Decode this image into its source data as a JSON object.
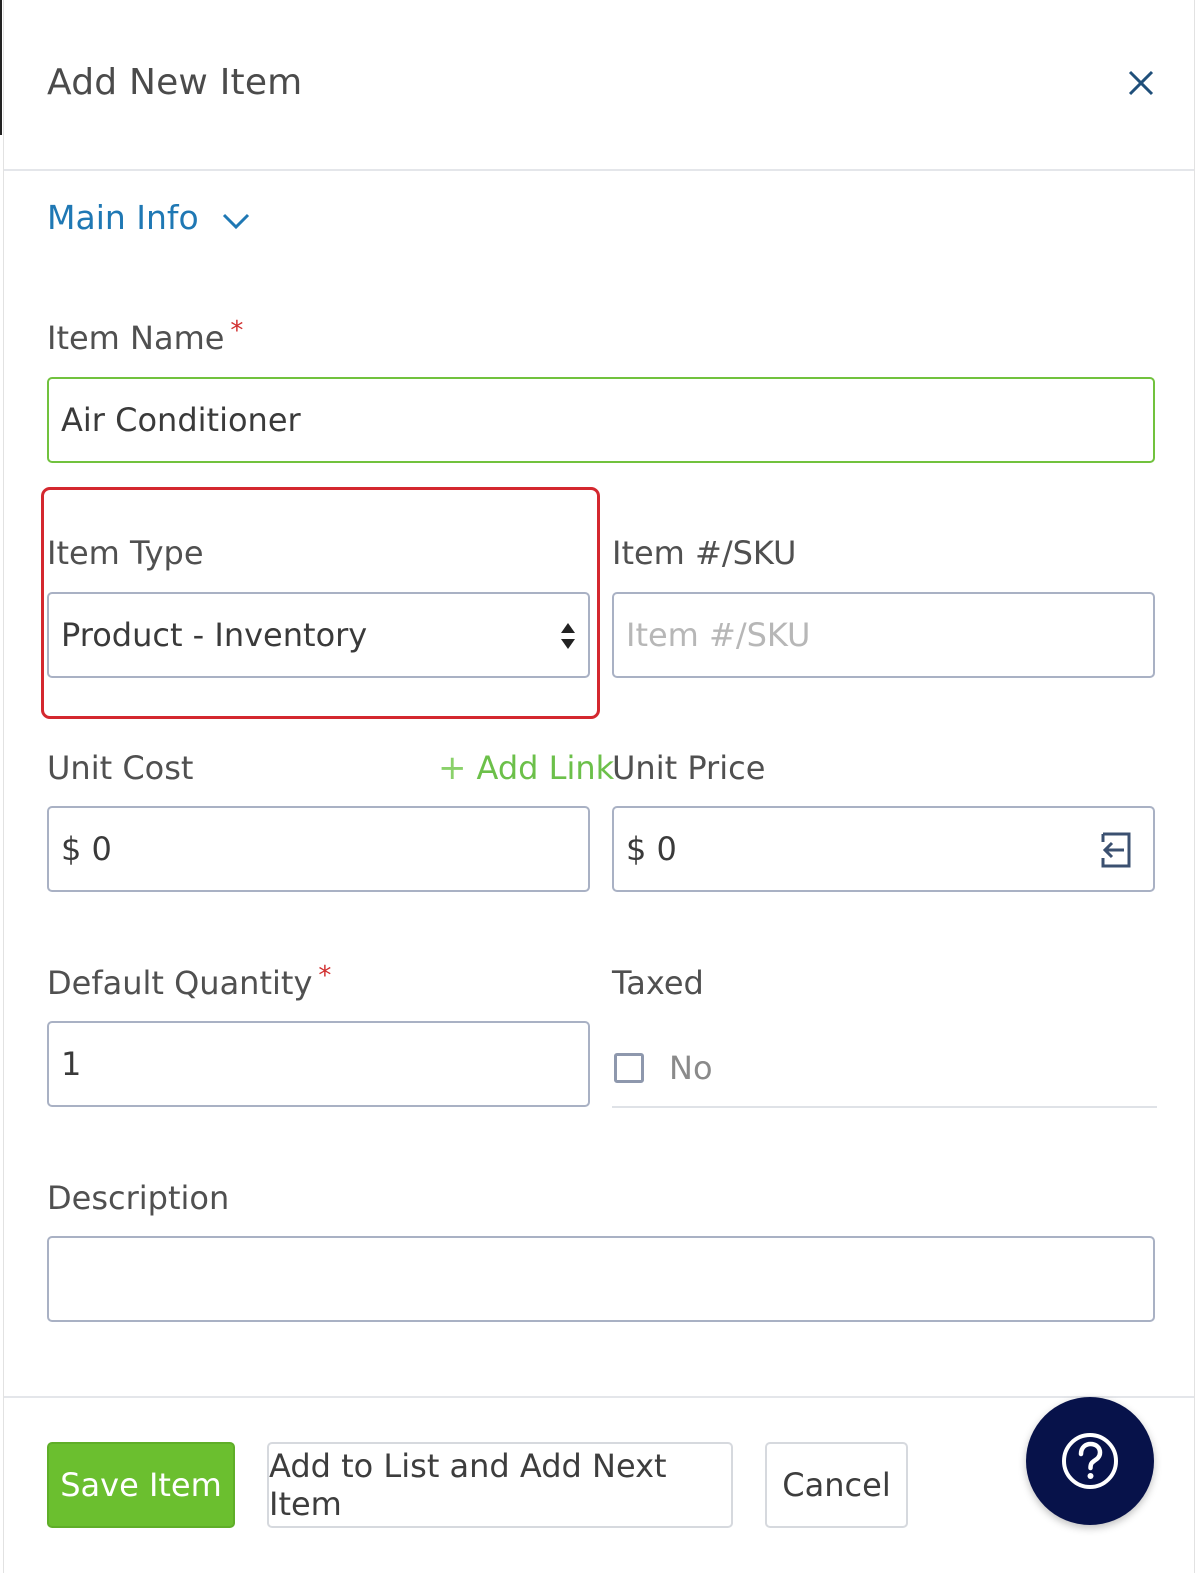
{
  "modal": {
    "title": "Add New Item"
  },
  "section": {
    "label": "Main Info"
  },
  "fields": {
    "item_name": {
      "label": "Item Name",
      "required_mark": "*",
      "value": "Air Conditioner"
    },
    "item_type": {
      "label": "Item Type",
      "value": "Product - Inventory"
    },
    "sku": {
      "label": "Item #/SKU",
      "placeholder": "Item #/SKU",
      "value": ""
    },
    "unit_cost": {
      "label": "Unit Cost",
      "value": "$ 0",
      "add_link": "Add Link"
    },
    "unit_price": {
      "label": "Unit Price",
      "value": "$ 0"
    },
    "default_quantity": {
      "label": "Default Quantity",
      "required_mark": "*",
      "value": "1"
    },
    "taxed": {
      "label": "Taxed",
      "checked": false,
      "value_label": "No"
    },
    "description": {
      "label": "Description",
      "value": ""
    }
  },
  "footer": {
    "save_label": "Save Item",
    "add_next_label": "Add to List and Add Next Item",
    "cancel_label": "Cancel"
  },
  "colors": {
    "accent_blue": "#1f78b4",
    "save_green": "#6bbf2f",
    "link_green": "#6cc04a",
    "required_red": "#d12f2f",
    "highlight_red": "#d4282f",
    "help_navy": "#07124a"
  },
  "icons": {
    "close": "close-icon",
    "section_toggle": "chevron-down-icon",
    "select": "sort-arrows-icon",
    "unit_price_action": "import-arrow-icon",
    "help": "question-circle-icon",
    "add_link": "plus-icon"
  }
}
